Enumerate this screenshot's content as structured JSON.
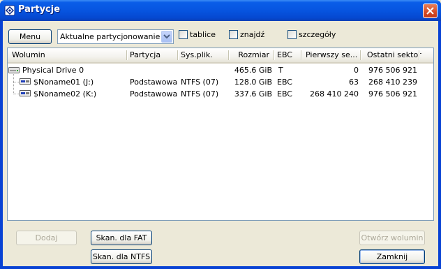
{
  "window": {
    "title": "Partycje"
  },
  "toolbar": {
    "menu_label": "Menu",
    "view_select_value": "Aktualne partycjonowanie",
    "checkboxes": [
      {
        "label": "tablice",
        "checked": false
      },
      {
        "label": "znajdź",
        "checked": false
      },
      {
        "label": "szczegóły",
        "checked": false
      }
    ]
  },
  "table": {
    "columns": [
      "Wolumin",
      "Partycja",
      "Sys.plik.",
      "Rozmiar",
      "EBC",
      "Pierwszy se...",
      "Ostatni sektor"
    ],
    "rows": [
      {
        "icon": "hard-drive-icon",
        "volume": "Physical Drive 0",
        "partition": "",
        "filesystem": "",
        "size": "465.6 GiB",
        "ebc": "T",
        "first_sector": "0",
        "last_sector": "976 506 921"
      },
      {
        "icon": "partition-icon",
        "volume": "$Noname01 (J:)",
        "partition": "Podstawowa",
        "filesystem": "NTFS (07)",
        "size": "128.0 GiB",
        "ebc": "EBC",
        "first_sector": "63",
        "last_sector": "268 410 239"
      },
      {
        "icon": "partition-icon",
        "volume": "$Noname02 (K:)",
        "partition": "Podstawowa",
        "filesystem": "NTFS (07)",
        "size": "337.6 GiB",
        "ebc": "EBC",
        "first_sector": "268 410 240",
        "last_sector": "976 506 921"
      }
    ]
  },
  "buttons": {
    "add": "Dodaj",
    "scan_fat": "Skan. dla FAT",
    "scan_ntfs": "Skan. dla NTFS",
    "open_volume": "Otwórz wolumin",
    "close": "Zamknij"
  },
  "colors": {
    "titlebar": "#0A5DE8",
    "close_button": "#D54A24",
    "dialog_bg": "#ECE9D8"
  }
}
